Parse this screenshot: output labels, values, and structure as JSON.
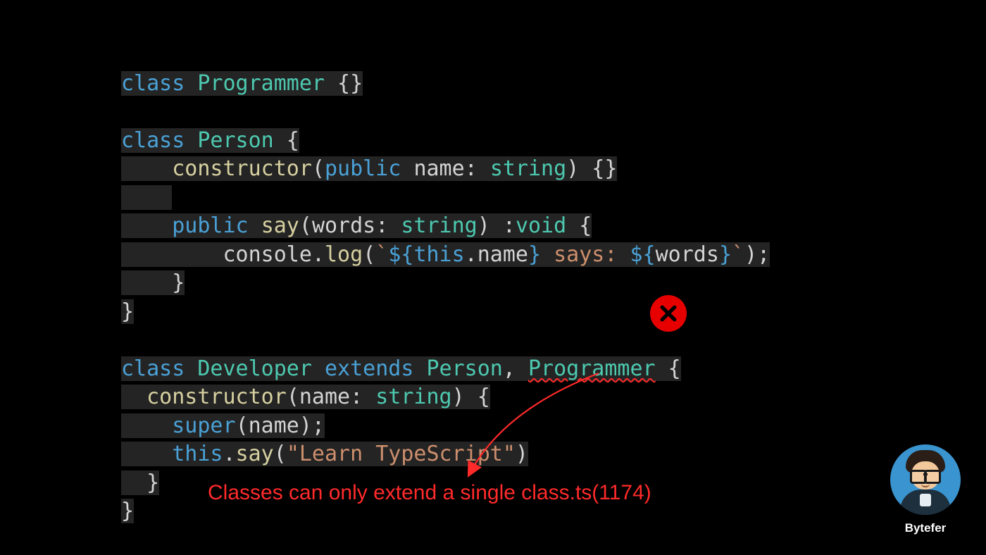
{
  "code": {
    "l1": {
      "kw_class": "class ",
      "cls": "Programmer",
      "rest": " {}"
    },
    "l3": {
      "kw_class": "class ",
      "cls": "Person",
      "brace": " {"
    },
    "l4": {
      "indent": "    ",
      "ctor": "constructor",
      "p1": "(",
      "pub": "public ",
      "arg": "name",
      "colon": ": ",
      "typ": "string",
      "p2": ") {}"
    },
    "l6": {
      "indent": "    ",
      "pub": "public ",
      "fn": "say",
      "p1": "(",
      "arg": "words",
      "colon": ": ",
      "typ": "string",
      "p2": ") :",
      "ret": "void",
      "brace": " {"
    },
    "l7": {
      "indent": "        ",
      "obj": "console",
      "dot": ".",
      "fn": "log",
      "p1": "(",
      "bt1": "`",
      "t1": "${",
      "thisk": "this",
      "d2": ".",
      "prop": "name",
      "t1c": "}",
      "str": " says: ",
      "t2": "${",
      "w": "words",
      "t2c": "}",
      "bt2": "`",
      "p2": ");"
    },
    "l8": {
      "indent": "    ",
      "close": "}"
    },
    "l9": {
      "close": "}"
    },
    "l11": {
      "kw_class": "class ",
      "cls": "Developer",
      "ext": " extends ",
      "p": "Person",
      "comma": ", ",
      "prog": "Programmer",
      "brace": " {"
    },
    "l12": {
      "indent": "  ",
      "ctor": "constructor",
      "p1": "(",
      "arg": "name",
      "colon": ": ",
      "typ": "string",
      "p2": ") {"
    },
    "l13": {
      "indent": "    ",
      "sup": "super",
      "p1": "(",
      "arg": "name",
      "p2": ");"
    },
    "l14": {
      "indent": "    ",
      "thisk": "this",
      "dot": ".",
      "fn": "say",
      "p1": "(",
      "str": "\"Learn TypeScript\"",
      "p2": ")"
    },
    "l15": {
      "indent": "  ",
      "close": "}"
    },
    "l16": {
      "close": "}"
    }
  },
  "error_message": "Classes can only extend a single class.ts(1174)",
  "author": "Bytefer"
}
